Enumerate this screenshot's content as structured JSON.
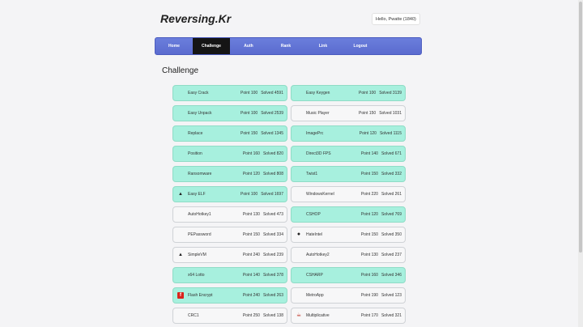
{
  "site": {
    "logo": "Reversing.Kr",
    "hello": "Hello, Pwatte (1840)"
  },
  "nav": [
    {
      "label": "Home",
      "active": false
    },
    {
      "label": "Challenge",
      "active": true
    },
    {
      "label": "Auth",
      "active": false
    },
    {
      "label": "Rank",
      "active": false
    },
    {
      "label": "Link",
      "active": false
    },
    {
      "label": "Logout",
      "active": false
    }
  ],
  "section_title": "Challenge",
  "challenges": [
    {
      "name": "Easy Crack",
      "point": "Point 100",
      "solved": "Solved 4591",
      "done": true,
      "icon": "windows-icon"
    },
    {
      "name": "Easy Keygen",
      "point": "Point 100",
      "solved": "Solved 3139",
      "done": true,
      "icon": "windows-icon"
    },
    {
      "name": "Easy Unpack",
      "point": "Point 100",
      "solved": "Solved 2539",
      "done": true,
      "icon": "windows-icon"
    },
    {
      "name": "Music Player",
      "point": "Point 150",
      "solved": "Solved 1031",
      "done": false,
      "icon": "windows-icon"
    },
    {
      "name": "Replace",
      "point": "Point 150",
      "solved": "Solved 1345",
      "done": true,
      "icon": "windows-icon"
    },
    {
      "name": "ImagePrc",
      "point": "Point 120",
      "solved": "Solved 1115",
      "done": true,
      "icon": "windows-icon"
    },
    {
      "name": "Position",
      "point": "Point 160",
      "solved": "Solved 820",
      "done": true,
      "icon": "windows-icon"
    },
    {
      "name": "Direct3D FPS",
      "point": "Point 140",
      "solved": "Solved 671",
      "done": true,
      "icon": "windows-icon"
    },
    {
      "name": "Ransomware",
      "point": "Point 120",
      "solved": "Solved 808",
      "done": true,
      "icon": "windows-icon"
    },
    {
      "name": "Twist1",
      "point": "Point 150",
      "solved": "Solved 332",
      "done": true,
      "icon": "windows-icon"
    },
    {
      "name": "Easy ELF",
      "point": "Point 100",
      "solved": "Solved 1697",
      "done": true,
      "icon": "linux-icon"
    },
    {
      "name": "WindowsKernel",
      "point": "Point 220",
      "solved": "Solved 261",
      "done": false,
      "icon": "windows-icon"
    },
    {
      "name": "AutoHotkey1",
      "point": "Point 130",
      "solved": "Solved 473",
      "done": false,
      "icon": "windows-icon"
    },
    {
      "name": "CSHOP",
      "point": "Point 120",
      "solved": "Solved 769",
      "done": true,
      "icon": "windows-icon"
    },
    {
      "name": "PEPassword",
      "point": "Point 150",
      "solved": "Solved 334",
      "done": false,
      "icon": "windows-icon"
    },
    {
      "name": "HateIntel",
      "point": "Point 150",
      "solved": "Solved 350",
      "done": false,
      "icon": "apple-icon"
    },
    {
      "name": "SimpleVM",
      "point": "Point 240",
      "solved": "Solved 239",
      "done": false,
      "icon": "linux-icon"
    },
    {
      "name": "AutoHotkey2",
      "point": "Point 130",
      "solved": "Solved 237",
      "done": false,
      "icon": "windows-icon"
    },
    {
      "name": "x64 Lotto",
      "point": "Point 140",
      "solved": "Solved 378",
      "done": true,
      "icon": "windows-icon"
    },
    {
      "name": "CSHARP",
      "point": "Point 160",
      "solved": "Solved 346",
      "done": true,
      "icon": "windows-icon"
    },
    {
      "name": "Flash Encrypt",
      "point": "Point 240",
      "solved": "Solved 263",
      "done": true,
      "icon": "flash-icon"
    },
    {
      "name": "MetroApp",
      "point": "Point 190",
      "solved": "Solved 123",
      "done": false,
      "icon": "windows-metro-icon"
    },
    {
      "name": "CRC1",
      "point": "Point 250",
      "solved": "Solved 138",
      "done": false,
      "icon": "windows-icon"
    },
    {
      "name": "Multiplicative",
      "point": "Point 170",
      "solved": "Solved 321",
      "done": false,
      "icon": "java-icon"
    }
  ],
  "colors": {
    "solved_bg": "#a7f0de",
    "nav_bg": "#5f71d4",
    "nav_active": "#151515"
  }
}
